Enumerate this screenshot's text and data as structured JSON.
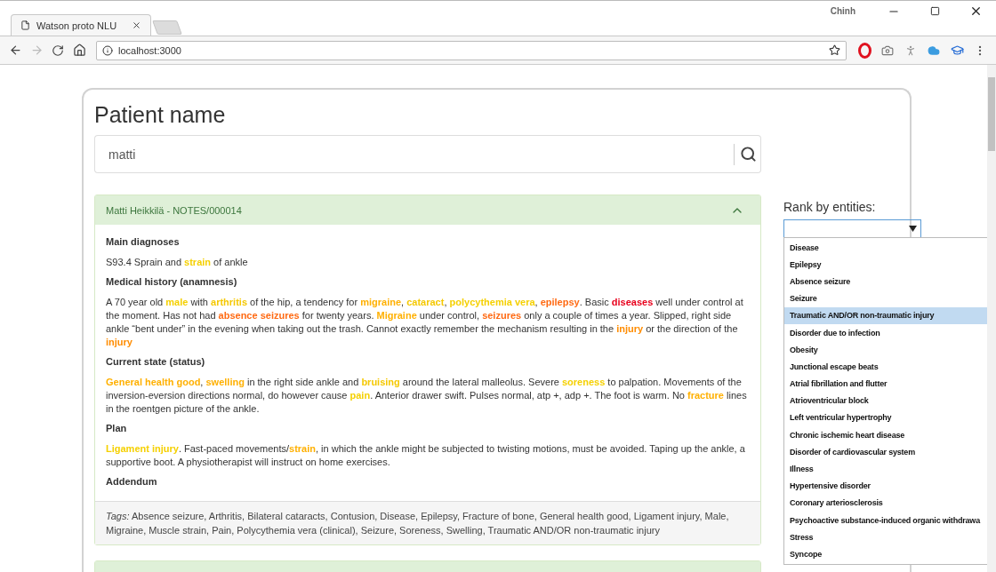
{
  "browser": {
    "tab_title": "Watson proto NLU",
    "user": "Chinh",
    "address": "localhost:3000"
  },
  "page": {
    "title": "Patient name",
    "search": {
      "value": "matti"
    },
    "notes": [
      {
        "header": "Matti Heikkilä - NOTES/000014",
        "expanded": true,
        "sections": [
          {
            "heading": "Main diagnoses",
            "paragraph": [
              {
                "text": "S93.4 Sprain and "
              },
              {
                "text": "strain",
                "color": "#f5d000"
              },
              {
                "text": " of ankle"
              }
            ]
          },
          {
            "heading": "Medical history (anamnesis)",
            "paragraph": [
              {
                "text": "A 70 year old "
              },
              {
                "text": "male",
                "color": "#f5d000"
              },
              {
                "text": " with "
              },
              {
                "text": "arthritis",
                "color": "#f5c800"
              },
              {
                "text": " of the hip, a tendency for "
              },
              {
                "text": "migraine",
                "color": "#ffb000"
              },
              {
                "text": ", "
              },
              {
                "text": "cataract",
                "color": "#f5c800"
              },
              {
                "text": ", "
              },
              {
                "text": "polycythemia vera",
                "color": "#f5d000"
              },
              {
                "text": ", "
              },
              {
                "text": "epilepsy",
                "color": "#ff6a13"
              },
              {
                "text": ". Basic "
              },
              {
                "text": "diseases",
                "color": "#e8001c"
              },
              {
                "text": " well under control at the moment. Has not had "
              },
              {
                "text": "absence seizures",
                "color": "#ff6a13"
              },
              {
                "text": " for twenty years. "
              },
              {
                "text": "Migraine",
                "color": "#ffb000"
              },
              {
                "text": " under control, "
              },
              {
                "text": "seizures",
                "color": "#ff6a13"
              },
              {
                "text": " only a couple of times a year. Slipped, right side ankle “bent under” in the evening when taking out the trash. Cannot exactly remember the mechanism resulting in the "
              },
              {
                "text": "injury",
                "color": "#ff8c00"
              },
              {
                "text": " or the direction of the "
              },
              {
                "text": "injury",
                "color": "#ff8c00"
              }
            ]
          },
          {
            "heading": "Current state (status)",
            "paragraph": [
              {
                "text": "General health good",
                "color": "#ffb000"
              },
              {
                "text": ", "
              },
              {
                "text": "swelling",
                "color": "#ffb000"
              },
              {
                "text": " in the right side ankle and "
              },
              {
                "text": "bruising",
                "color": "#f5c800"
              },
              {
                "text": " around the lateral malleolus. Severe "
              },
              {
                "text": "soreness",
                "color": "#f5d000"
              },
              {
                "text": " to palpation. Movements of the inversion-eversion directions normal, do however cause "
              },
              {
                "text": "pain",
                "color": "#f5d000"
              },
              {
                "text": ". Anterior drawer swift. Pulses normal, atp +, adp +. The foot is warm. No "
              },
              {
                "text": "fracture",
                "color": "#ffb000"
              },
              {
                "text": " lines in the roentgen picture of the ankle."
              }
            ]
          },
          {
            "heading": "Plan",
            "paragraph": [
              {
                "text": "Ligament injury",
                "color": "#f5d000"
              },
              {
                "text": ". Fast-paced movements/"
              },
              {
                "text": "strain",
                "color": "#ffb000"
              },
              {
                "text": ", in which the ankle might be subjected to twisting motions, must be avoided. Taping up the ankle, a supportive boot. A physiotherapist will instruct on home exercises."
              }
            ]
          },
          {
            "heading": "Addendum"
          }
        ],
        "tags": "*Tags:* Absence seizure, Arthritis, Bilateral cataracts, Contusion, Disease, Epilepsy, Fracture of bone, General health good, Ligament injury, Male, Migraine, Muscle strain, Pain, Polycythemia vera (clinical), Seizure, Soreness, Swelling, Traumatic AND/OR non-traumatic injury"
      },
      {
        "expanded": false
      }
    ],
    "ranking": {
      "label": "Rank by entities:",
      "open": true,
      "options": [
        {
          "label": "Disease",
          "selected": false
        },
        {
          "label": "Epilepsy",
          "selected": false
        },
        {
          "label": "Absence seizure",
          "selected": false
        },
        {
          "label": "Seizure",
          "selected": false
        },
        {
          "label": "Traumatic AND/OR non-traumatic injury",
          "selected": true
        },
        {
          "label": "Disorder due to infection",
          "selected": false
        },
        {
          "label": "Obesity",
          "selected": false
        },
        {
          "label": "Junctional escape beats",
          "selected": false
        },
        {
          "label": "Atrial fibrillation and flutter",
          "selected": false
        },
        {
          "label": "Atrioventricular block",
          "selected": false
        },
        {
          "label": "Left ventricular hypertrophy",
          "selected": false
        },
        {
          "label": "Chronic ischemic heart disease",
          "selected": false
        },
        {
          "label": "Disorder of cardiovascular system",
          "selected": false
        },
        {
          "label": "Illness",
          "selected": false
        },
        {
          "label": "Hypertensive disorder",
          "selected": false
        },
        {
          "label": "Coronary arteriosclerosis",
          "selected": false
        },
        {
          "label": "Psychoactive substance-induced organic withdrawa",
          "selected": false
        },
        {
          "label": "Stress",
          "selected": false
        },
        {
          "label": "Syncope",
          "selected": false
        }
      ]
    }
  }
}
